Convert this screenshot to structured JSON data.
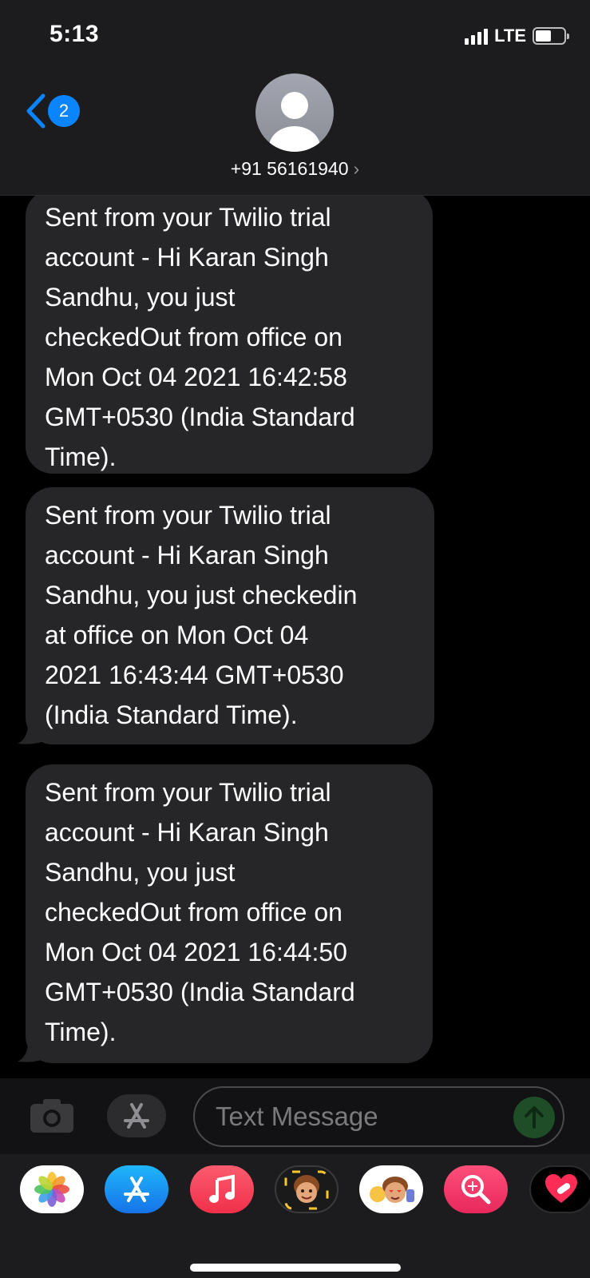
{
  "status": {
    "time": "5:13",
    "network": "LTE"
  },
  "header": {
    "unread_count": "2",
    "contact": "+91 56161940",
    "contact_chevron": "›"
  },
  "messages": [
    {
      "text": "Sent from your Twilio trial\naccount - Hi Karan Singh\nSandhu, you just\ncheckedOut from office on\nMon Oct 04 2021 16:42:58\nGMT+0530 (India Standard\nTime)."
    },
    {
      "text": "Sent from your Twilio trial\naccount - Hi Karan Singh\nSandhu, you just checkedin\nat office on Mon Oct 04\n2021 16:43:44 GMT+0530\n(India Standard Time)."
    },
    {
      "text": "Sent from your Twilio trial\naccount - Hi Karan Singh\nSandhu, you just\ncheckedOut from office on\nMon Oct 04 2021 16:44:50\nGMT+0530 (India Standard\nTime)."
    }
  ],
  "composer": {
    "placeholder": "Text Message"
  },
  "app_drawer": [
    {
      "icon": "photos-icon"
    },
    {
      "icon": "app-store-icon"
    },
    {
      "icon": "music-icon"
    },
    {
      "icon": "memoji-icon"
    },
    {
      "icon": "animoji-stickers-icon"
    },
    {
      "icon": "image-search-icon"
    },
    {
      "icon": "digital-touch-icon"
    }
  ],
  "colors": {
    "accent": "#0a84ff",
    "bubble": "#262628",
    "header": "#1c1c1e",
    "send": "#1e4d27"
  }
}
